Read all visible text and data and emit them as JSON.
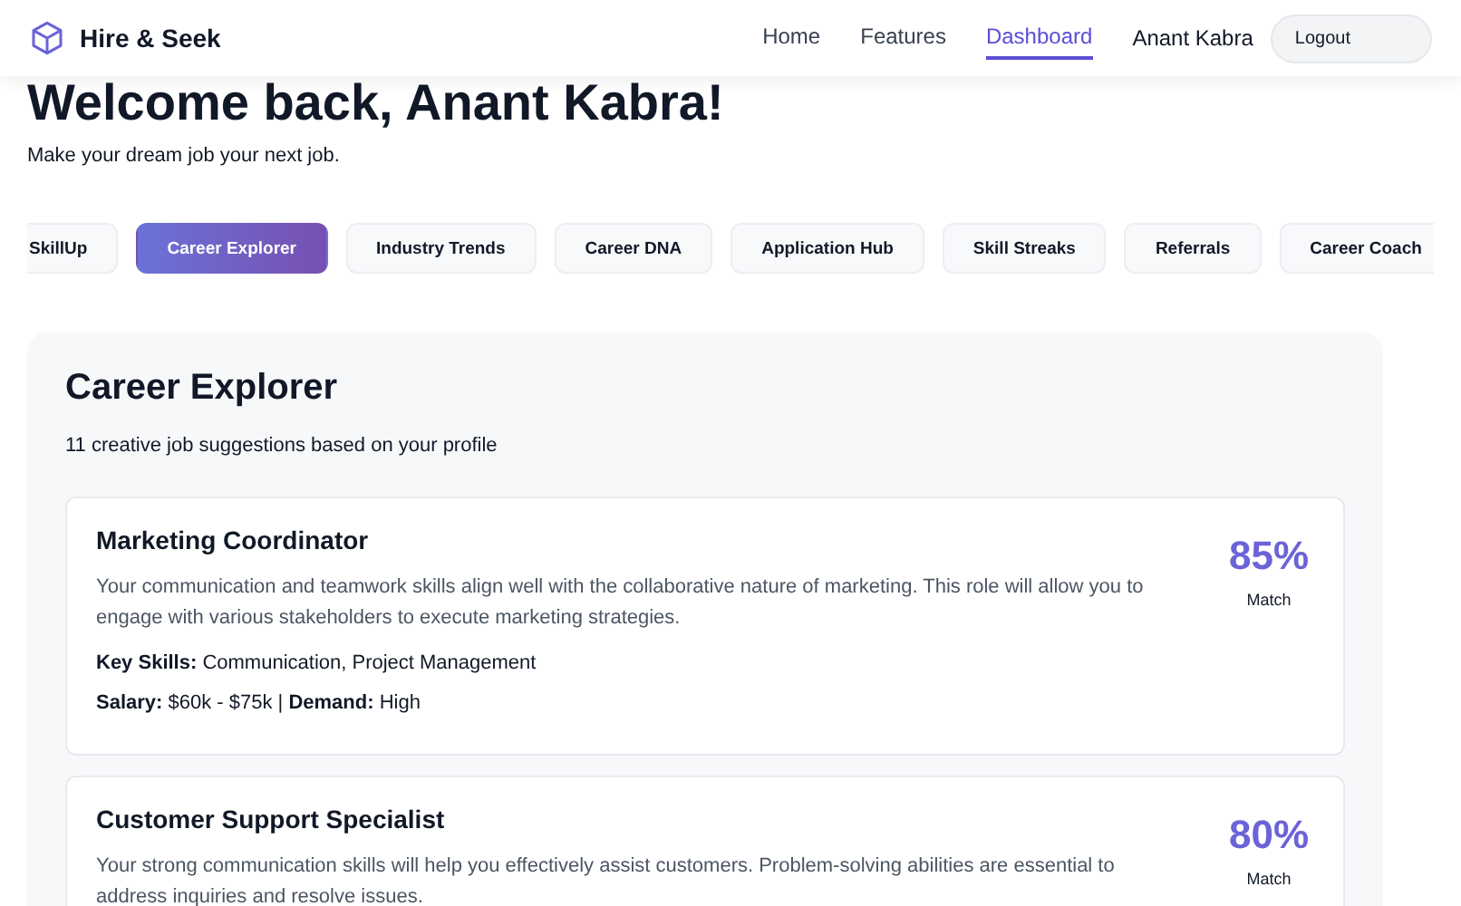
{
  "brand": "Hire & Seek",
  "nav": [
    {
      "label": "Home",
      "selected": false
    },
    {
      "label": "Features",
      "selected": false
    },
    {
      "label": "Dashboard",
      "selected": true
    }
  ],
  "user": "Anant Kabra",
  "logout": "Logout",
  "welcome": "Welcome back, Anant Kabra!",
  "tagline": "Make your dream job your next job.",
  "tabs": [
    {
      "label": "SkillUp",
      "selected": false
    },
    {
      "label": "Career Explorer",
      "selected": true
    },
    {
      "label": "Industry Trends",
      "selected": false
    },
    {
      "label": "Career DNA",
      "selected": false
    },
    {
      "label": "Application Hub",
      "selected": false
    },
    {
      "label": "Skill Streaks",
      "selected": false
    },
    {
      "label": "Referrals",
      "selected": false
    },
    {
      "label": "Career Coach",
      "selected": false
    }
  ],
  "panel": {
    "title": "Career Explorer",
    "subtitle": "11 creative job suggestions based on your profile",
    "jobs": [
      {
        "title": "Marketing Coordinator",
        "description": "Your communication and teamwork skills align well with the collaborative nature of marketing. This role will allow you to engage with various stakeholders to execute marketing strategies.",
        "skills": "**Key Skills:** Communication, Project Management",
        "salary": "**Salary:** $60k - $75k | **Demand:** High",
        "match": "85%",
        "match_label": "Match"
      },
      {
        "title": "Customer Support Specialist",
        "description": "Your strong communication skills will help you effectively assist customers. Problem-solving abilities are essential to address inquiries and resolve issues.",
        "match": "80%",
        "match_label": "Match"
      }
    ]
  }
}
